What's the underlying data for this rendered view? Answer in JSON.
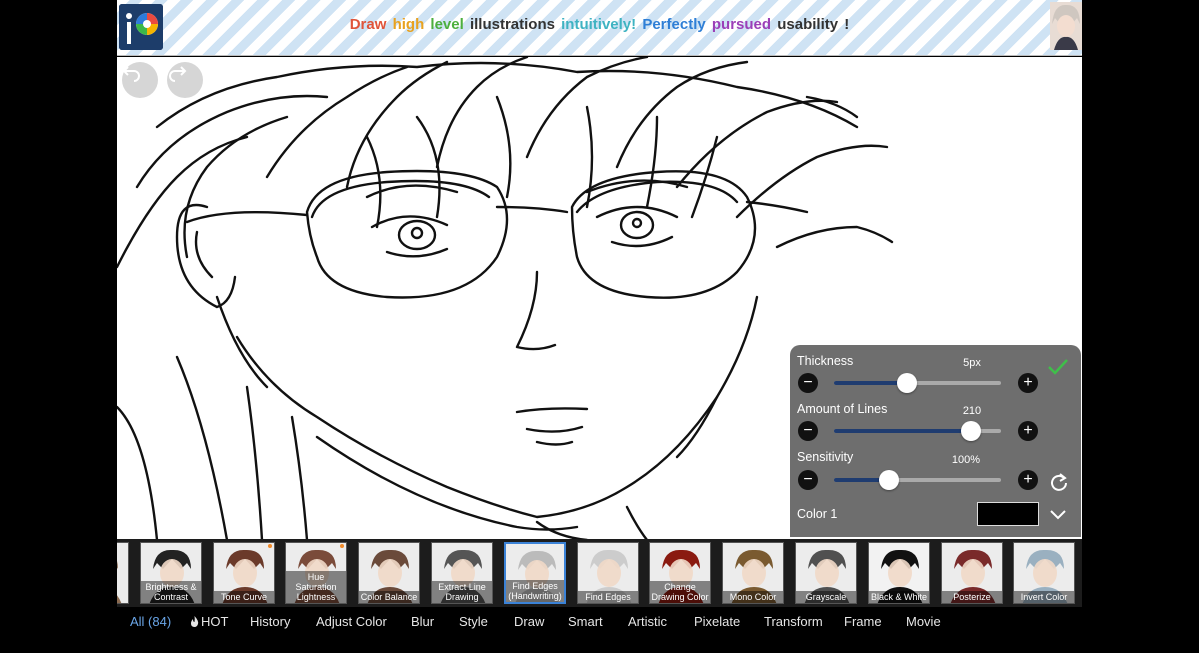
{
  "banner": {
    "segments": [
      {
        "text": "Draw",
        "color": "#e0543a"
      },
      {
        "text": "high",
        "color": "#e8a21f"
      },
      {
        "text": "level",
        "color": "#4caf3e"
      },
      {
        "text": "illustrations",
        "color": "#333333"
      },
      {
        "text": "intuitively!",
        "color": "#3fb3c2"
      },
      {
        "text": "Perfectly",
        "color": "#2f7fd6"
      },
      {
        "text": "pursued",
        "color": "#9b3fb8"
      },
      {
        "text": "usability",
        "color": "#333333"
      },
      {
        "text": "!",
        "color": "#333333"
      }
    ],
    "logo_icon": "ibispaint-logo-icon",
    "avatar_icon": "advertiser-avatar"
  },
  "history": {
    "undo_icon": "undo-icon",
    "redo_icon": "redo-icon"
  },
  "panel": {
    "thickness": {
      "label": "Thickness",
      "value_text": "5px",
      "level": 0.44
    },
    "amount_of_lines": {
      "label": "Amount of Lines",
      "value_text": "210",
      "level": 0.82
    },
    "sensitivity": {
      "label": "Sensitivity",
      "value_text": "100%",
      "level": 0.33
    },
    "color1": {
      "label": "Color 1",
      "value": "#000000"
    },
    "minus_symbol": "−",
    "plus_symbol": "+",
    "confirm_icon": "checkmark-icon",
    "reset_icon": "reset-icon",
    "expand_icon": "chevron-down-icon",
    "accent_color": "#1f3c70"
  },
  "filters": [
    {
      "label": "",
      "tone": "#8a6a50",
      "hot": false,
      "selected": false
    },
    {
      "label": "Brightness & Contrast",
      "tone": "#222222",
      "hot": false,
      "selected": false
    },
    {
      "label": "Tone Curve",
      "tone": "#6b3a2a",
      "hot": true,
      "selected": false
    },
    {
      "label": "Hue Saturation Lightness",
      "tone": "#7a4b3a",
      "hot": true,
      "selected": false
    },
    {
      "label": "Color Balance",
      "tone": "#6a4a3a",
      "hot": false,
      "selected": false
    },
    {
      "label": "Extract Line Drawing",
      "tone": "#555555",
      "hot": false,
      "selected": false
    },
    {
      "label": "Find Edges (Handwriting)",
      "tone": "#bbbbbb",
      "hot": false,
      "selected": true
    },
    {
      "label": "Find Edges",
      "tone": "#cccccc",
      "hot": false,
      "selected": false
    },
    {
      "label": "Change Drawing Color",
      "tone": "#8a1a10",
      "hot": false,
      "selected": false
    },
    {
      "label": "Mono Color",
      "tone": "#7a5a30",
      "hot": false,
      "selected": false
    },
    {
      "label": "Grayscale",
      "tone": "#505050",
      "hot": false,
      "selected": false
    },
    {
      "label": "Black & White",
      "tone": "#111111",
      "hot": false,
      "selected": false
    },
    {
      "label": "Posterize",
      "tone": "#7a2a2a",
      "hot": false,
      "selected": false
    },
    {
      "label": "Invert Color",
      "tone": "#9ab0c0",
      "hot": false,
      "selected": false
    }
  ],
  "categories": [
    {
      "label": "All (84)",
      "active": true
    },
    {
      "label": "HOT",
      "active": false,
      "icon": "flame-icon"
    },
    {
      "label": "History",
      "active": false
    },
    {
      "label": "Adjust Color",
      "active": false
    },
    {
      "label": "Blur",
      "active": false
    },
    {
      "label": "Style",
      "active": false
    },
    {
      "label": "Draw",
      "active": false
    },
    {
      "label": "Smart",
      "active": false
    },
    {
      "label": "Artistic",
      "active": false
    },
    {
      "label": "Pixelate",
      "active": false
    },
    {
      "label": "Transform",
      "active": false
    },
    {
      "label": "Frame",
      "active": false
    },
    {
      "label": "Movie",
      "active": false
    }
  ]
}
